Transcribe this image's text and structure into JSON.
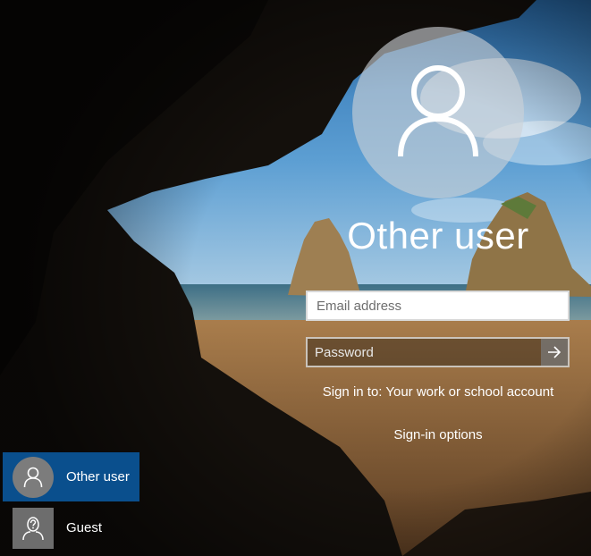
{
  "screen": {
    "title": "Other user",
    "email_placeholder": "Email address",
    "password_placeholder": "Password",
    "sign_in_to": "Sign in to: Your work or school account",
    "sign_in_options": "Sign-in options"
  },
  "icons": {
    "avatar": "user-silhouette-icon",
    "submit": "arrow-right-icon",
    "guest": "guest-icon"
  },
  "user_list": [
    {
      "label": "Other user",
      "selected": true
    },
    {
      "label": "Guest",
      "selected": false
    }
  ],
  "colors": {
    "selected_user_bg": "#0a4f8d",
    "text": "#ffffff"
  }
}
